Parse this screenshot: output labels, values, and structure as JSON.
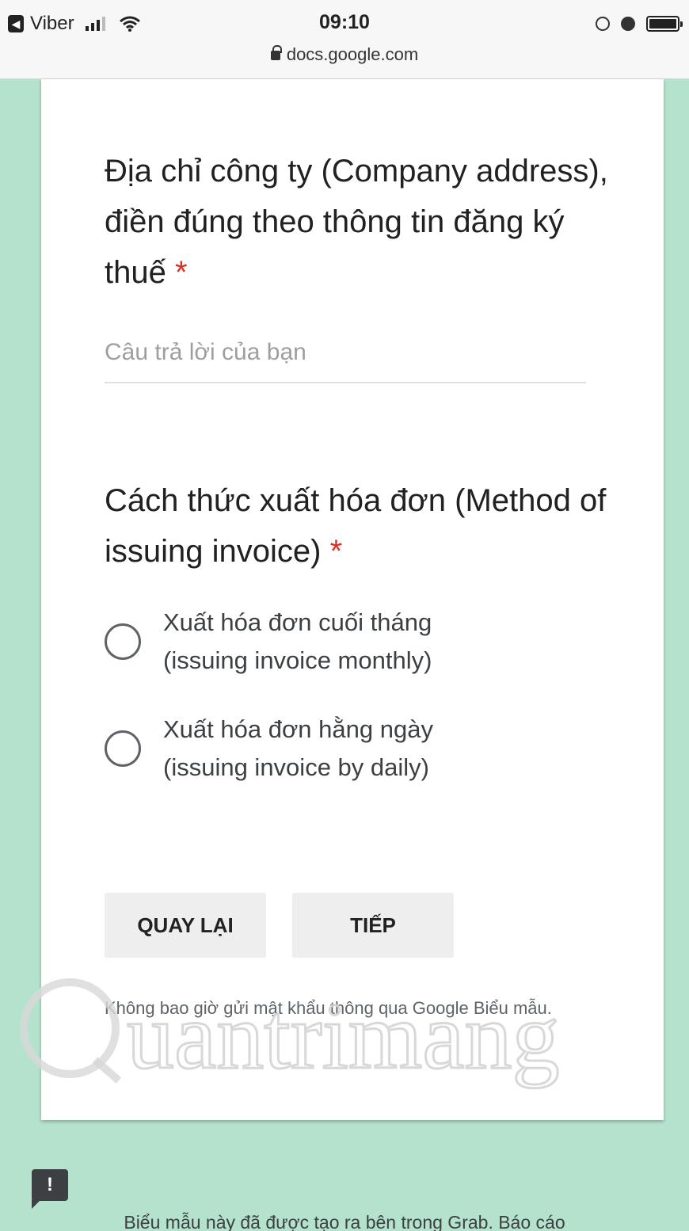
{
  "status_bar": {
    "app_name": "Viber",
    "time": "09:10",
    "url": "docs.google.com"
  },
  "form": {
    "question1": {
      "title": "Địa chỉ công ty (Company address), điền đúng theo thông tin đăng ký thuế",
      "required_mark": "*",
      "placeholder": "Câu trả lời của bạn"
    },
    "question2": {
      "title": "Cách thức xuất hóa đơn (Method of issuing invoice)",
      "required_mark": "*",
      "options": [
        {
          "line1": "Xuất hóa đơn cuối tháng",
          "line2": "(issuing invoice monthly)"
        },
        {
          "line1": "Xuất hóa đơn hằng ngày",
          "line2": "(issuing invoice by daily)"
        }
      ]
    },
    "buttons": {
      "back": "QUAY LẠI",
      "next": "TIẾP"
    },
    "disclaimer": "Không bao giờ gửi mật khẩu thông qua Google Biểu mẫu."
  },
  "footer": {
    "report_icon_glyph": "!",
    "text": "Biểu mẫu này đã được tạo ra bên trong Grab. Báo cáo"
  },
  "watermark": {
    "text": "uantrimang"
  },
  "colors": {
    "page_bg": "#b4e2cc",
    "required": "#d93025"
  }
}
